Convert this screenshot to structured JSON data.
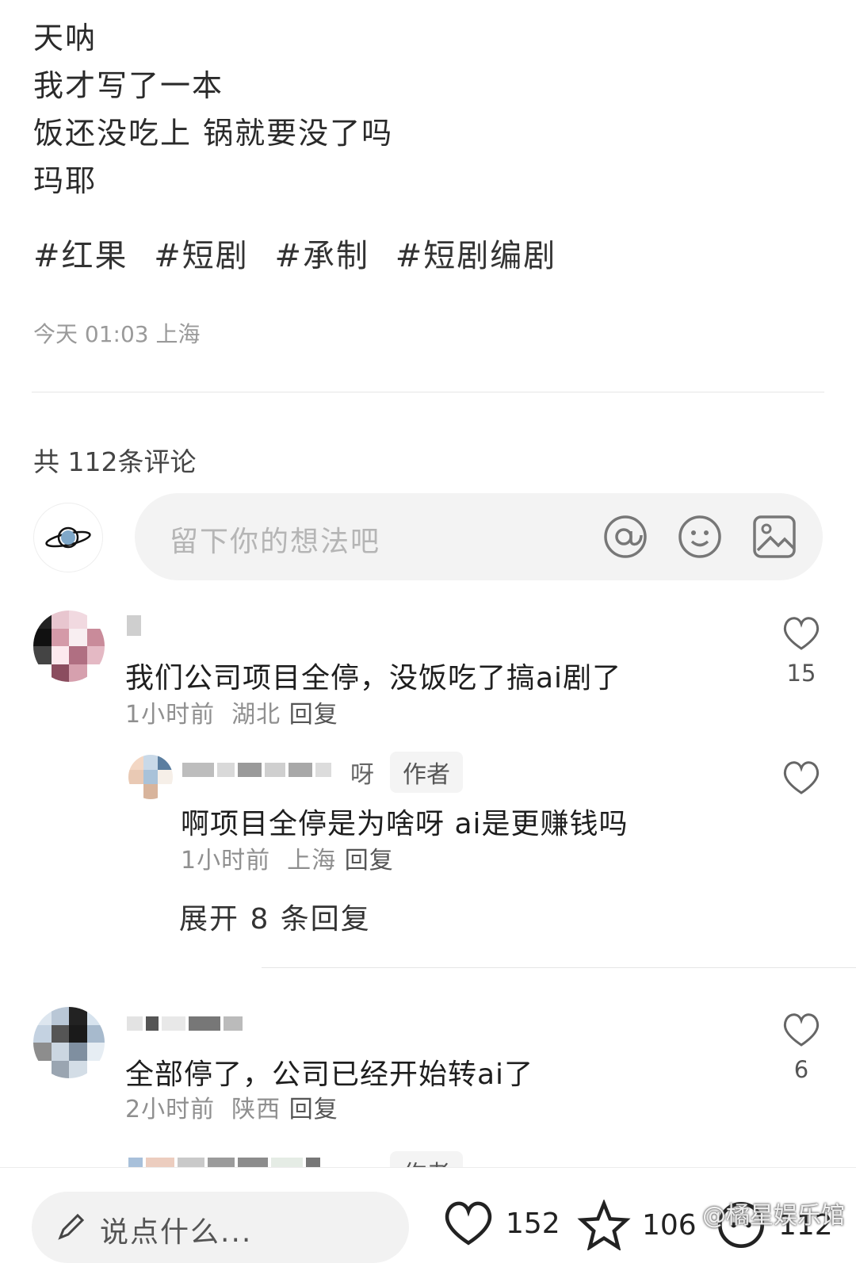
{
  "post": {
    "lines": [
      "天呐",
      "我才写了一本",
      "饭还没吃上 锅就要没了吗",
      "玛耶"
    ],
    "tags": [
      "#红果",
      "#短剧",
      "#承制",
      "#短剧编剧"
    ],
    "meta": "今天 01:03 上海"
  },
  "comments_header": {
    "count_text": "共 112条评论"
  },
  "input": {
    "placeholder": "留下你的想法吧",
    "icons": [
      "at-icon",
      "emoji-icon",
      "image-icon"
    ]
  },
  "comments": [
    {
      "text": "我们公司项目全停，没饭吃了搞ai剧了",
      "meta_time": "1小时前",
      "meta_loc": "湖北",
      "reply_label": "回复",
      "likes": "15",
      "replies": [
        {
          "name_visible": "呀",
          "badge": "作者",
          "text": "啊项目全停是为啥呀 ai是更赚钱吗",
          "meta_time": "1小时前",
          "meta_loc": "上海",
          "reply_label": "回复"
        }
      ],
      "expand_label": "展开 8 条回复"
    },
    {
      "text": "全部停了，公司已经开始转ai了",
      "meta_time": "2小时前",
      "meta_loc": "陕西",
      "reply_label": "回复",
      "likes": "6",
      "replies": [
        {
          "badge": "作者"
        }
      ]
    }
  ],
  "bottom_bar": {
    "input_label": "说点什么...",
    "likes": "152",
    "stars": "106",
    "comments": "112"
  },
  "watermark": "@橘星娱乐馆",
  "colors": {
    "text": "#222222",
    "muted": "#9a9a9a",
    "input_bg": "#f3f3f3"
  }
}
